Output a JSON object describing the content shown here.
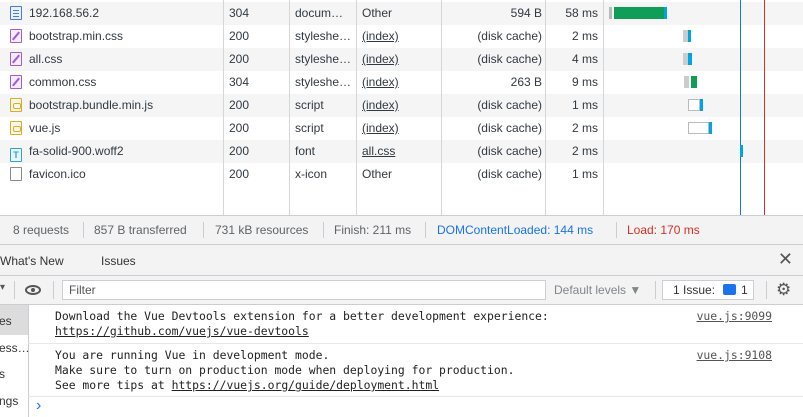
{
  "requests": [
    {
      "icon": "doc",
      "name": "192.168.56.2",
      "status": "304",
      "type": "docum…",
      "initiator": "Other",
      "initiator_link": false,
      "size": "594 B",
      "time": "58 ms"
    },
    {
      "icon": "css",
      "name": "bootstrap.min.css",
      "status": "200",
      "type": "styleshe…",
      "initiator": "(index)",
      "initiator_link": true,
      "size": "(disk cache)",
      "time": "2 ms"
    },
    {
      "icon": "css",
      "name": "all.css",
      "status": "200",
      "type": "styleshe…",
      "initiator": "(index)",
      "initiator_link": true,
      "size": "(disk cache)",
      "time": "4 ms"
    },
    {
      "icon": "css",
      "name": "common.css",
      "status": "304",
      "type": "styleshe…",
      "initiator": "(index)",
      "initiator_link": true,
      "size": "263 B",
      "time": "9 ms"
    },
    {
      "icon": "js",
      "name": "bootstrap.bundle.min.js",
      "status": "200",
      "type": "script",
      "initiator": "(index)",
      "initiator_link": true,
      "size": "(disk cache)",
      "time": "1 ms"
    },
    {
      "icon": "js",
      "name": "vue.js",
      "status": "200",
      "type": "script",
      "initiator": "(index)",
      "initiator_link": true,
      "size": "(disk cache)",
      "time": "2 ms"
    },
    {
      "icon": "font",
      "name": "fa-solid-900.woff2",
      "status": "200",
      "type": "font",
      "initiator": "all.css",
      "initiator_link": true,
      "size": "(disk cache)",
      "time": "2 ms"
    },
    {
      "icon": "plain",
      "name": "favicon.ico",
      "status": "200",
      "type": "x-icon",
      "initiator": "Other",
      "initiator_link": false,
      "size": "(disk cache)",
      "time": "1 ms"
    }
  ],
  "summary": {
    "requests": "8 requests",
    "transferred": "857 B transferred",
    "resources": "731 kB resources",
    "finish": "Finish: 211 ms",
    "dom_content_loaded": "DOMContentLoaded: 144 ms",
    "load": "Load: 170 ms"
  },
  "colors": {
    "dcl_line": "#1a73e8",
    "load_line": "#d93025",
    "waterfall_green": "#0f9d58",
    "waterfall_blue": "#00a4e4"
  },
  "drawer": {
    "tabs": [
      "What's New",
      "Issues"
    ]
  },
  "console_toolbar": {
    "filter_placeholder": "Filter",
    "levels": "Default levels ▼",
    "issues_label": "1 Issue:",
    "issues_count": "1"
  },
  "sidebar": {
    "items": [
      "es",
      "ess…",
      "s",
      "ngs"
    ]
  },
  "messages": [
    {
      "lines": [
        "Download the Vue Devtools extension for a better development experience:"
      ],
      "link": "https://github.com/vuejs/vue-devtools",
      "link_prefix": "",
      "source": "vue.js:9099"
    },
    {
      "lines": [
        "You are running Vue in development mode.",
        "Make sure to turn on production mode when deploying for production."
      ],
      "link_prefix": "See more tips at ",
      "link": "https://vuejs.org/guide/deployment.html",
      "source": "vue.js:9108"
    }
  ],
  "prompt_symbol": "›"
}
